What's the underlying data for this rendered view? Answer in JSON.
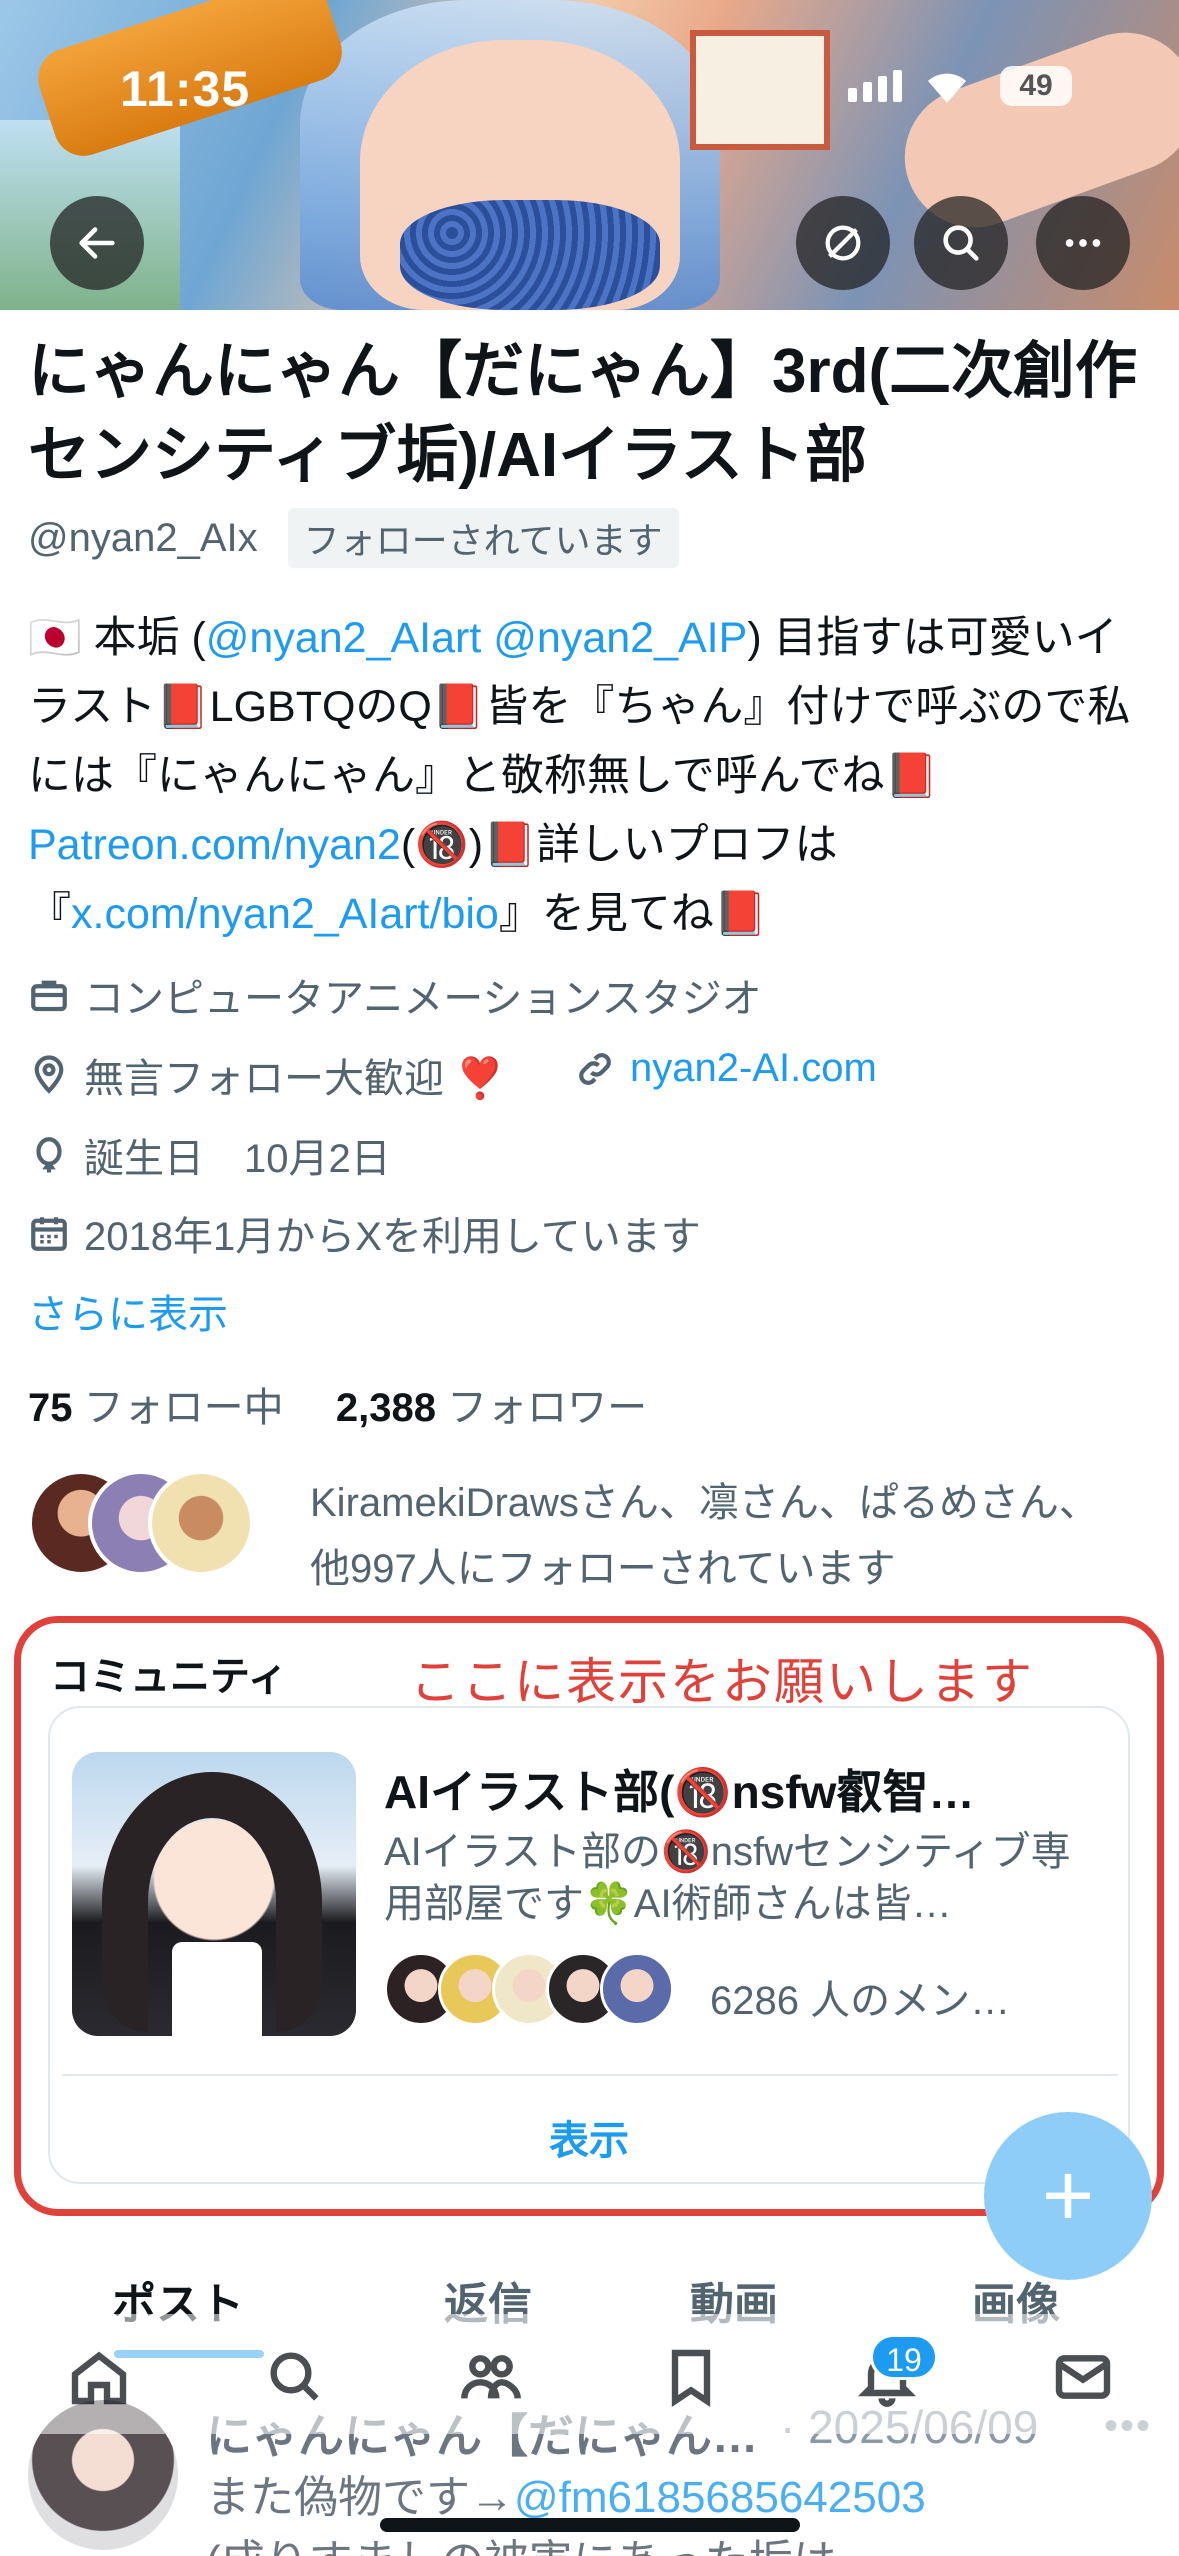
{
  "status_bar": {
    "time": "11:35",
    "battery": "49"
  },
  "profile": {
    "display_name": "にゃんにゃん【だにゃん】3rd(二次創作センシティブ垢)/AIイラスト部",
    "handle": "@nyan2_AIx",
    "follows_you": "フォローされています",
    "bio": {
      "flag": "🇯🇵",
      "part1": " 本垢 (",
      "link1": "@nyan2_AIart",
      "link2": "@nyan2_AIP",
      "part2": ") 目指すは可愛いイラスト📕LGBTQのQ📕皆を『ちゃん』付けで呼ぶので私には『にゃんにゃん』と敬称無しで呼んでね📕",
      "link3": "Patreon.com/nyan2",
      "part3": "(🔞)📕詳しいプロフは『",
      "link4": "x.com/nyan2_AIart/bio",
      "part4": "』を見てね📕"
    },
    "category": "コンピュータアニメーションスタジオ",
    "location": "無言フォロー大歓迎 ❣️",
    "website": "nyan2-AI.com",
    "birthday": "誕生日　10月2日",
    "joined": "2018年1月からXを利用しています",
    "show_more": "さらに表示",
    "following_count": "75",
    "following_label": " フォロー中",
    "followers_count": "2,388",
    "followers_label": " フォロワー",
    "followed_by": "KiramekiDrawsさん、凛さん、ぱるめさん、他997人にフォローされています"
  },
  "community": {
    "section_label": "コミュニティ",
    "annotation": "ここに表示をお願いします",
    "title": "AIイラスト部(🔞nsfw叡智…",
    "description": "AIイラスト部の🔞nsfwセンシティブ専用部屋です🍀AI術師さんは皆…",
    "members": "6286 人のメン…",
    "show_button": "表示"
  },
  "tabs": [
    "ポスト",
    "返信",
    "動画",
    "画像"
  ],
  "nav": {
    "notifications_badge": "19"
  },
  "post": {
    "author": "にゃんにゃん【だにゃん…",
    "date": "· 2025/06/09",
    "text_prefix": "また偽物です→",
    "mention": "@fm6185685642503",
    "text_line2": "(成りすましの被害にあった垢は"
  },
  "colors": {
    "accent": "#1d9bf0",
    "annotation_red": "#e0423b"
  }
}
